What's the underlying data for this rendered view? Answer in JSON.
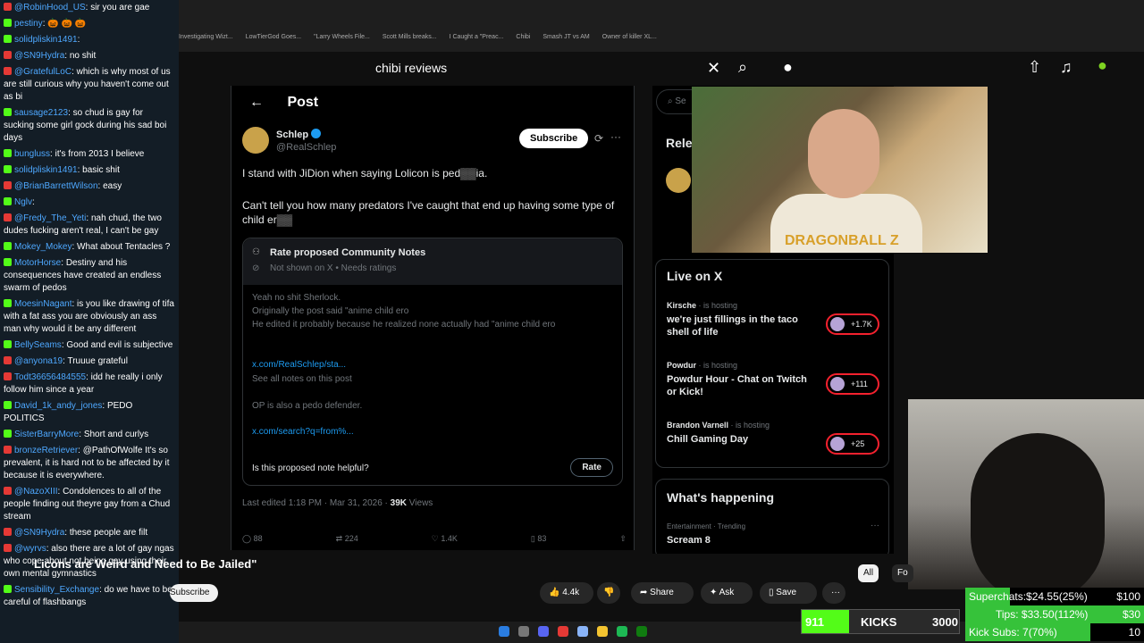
{
  "chat": [
    {
      "platform": "yt",
      "user": "@RobinHood_US",
      "text": "sir you are gae"
    },
    {
      "platform": "kick",
      "user": "pestiny",
      "text": "🎃 🎃 🎃"
    },
    {
      "platform": "kick",
      "user": "solidpliskin1491",
      "text": ""
    },
    {
      "platform": "yt",
      "user": "@SN9Hydra",
      "text": "no shit"
    },
    {
      "platform": "yt",
      "user": "@GratefulLoC",
      "text": "which is why most of us are still curious why you haven't come out as bi"
    },
    {
      "platform": "kick",
      "user": "sausage2123",
      "text": "so chud is gay for sucking some girl gock during his sad boi days"
    },
    {
      "platform": "kick",
      "user": "bungluss",
      "text": "it's from 2013 I believe"
    },
    {
      "platform": "kick",
      "user": "solidpliskin1491",
      "text": "basic shit"
    },
    {
      "platform": "yt",
      "user": "@BrianBarrettWilson",
      "text": "easy"
    },
    {
      "platform": "kick",
      "user": "Nglv",
      "text": ""
    },
    {
      "platform": "yt",
      "user": "@Fredy_The_Yeti",
      "text": "nah chud, the two dudes fucking aren't real, I can't be gay"
    },
    {
      "platform": "kick",
      "user": "Mokey_Mokey",
      "text": "What about Tentacles ?"
    },
    {
      "platform": "kick",
      "user": "MotorHorse",
      "text": "Destiny and his consequences have created an endless swarm of pedos"
    },
    {
      "platform": "kick",
      "user": "MoesinNagant",
      "text": "is you like drawing of tifa with a fat ass you are obviously an ass man why would it be any different"
    },
    {
      "platform": "kick",
      "user": "BellySeams",
      "text": "Good and evil is subjective"
    },
    {
      "platform": "yt",
      "user": "@anyona19",
      "text": "Truuue grateful"
    },
    {
      "platform": "yt",
      "user": "Todt36656484555",
      "text": "idd he really i only follow him since a year"
    },
    {
      "platform": "kick",
      "user": "David_1k_andy_jones",
      "text": "PEDO POLITICS"
    },
    {
      "platform": "kick",
      "user": "SisterBarryMore",
      "text": "Short and curlys"
    },
    {
      "platform": "yt",
      "user": "bronzeRetriever",
      "text": "@PathOfWolfe It's so prevalent, it is hard not to be affected by it because it is everywhere."
    },
    {
      "platform": "yt",
      "user": "@NazoXIII",
      "text": "Condolences to all of the people finding out theyre gay from a Chud stream"
    },
    {
      "platform": "yt",
      "user": "@SN9Hydra",
      "text": "these people are filt"
    },
    {
      "platform": "yt",
      "user": "@wyrvs",
      "text": "also there are a lot of gay ngas who cope about not being gay using their own mental gymnastics"
    },
    {
      "platform": "kick",
      "user": "Sensibility_Exchange",
      "text": "do we have to be careful of flashbangs"
    }
  ],
  "bookmarks": [
    "Investigating Wizt...",
    "LowTierGod Goes...",
    "\"Larry Wheels File...",
    "Scott Mills breaks...",
    "I Caught a \"Preac...",
    "Chibi",
    "Smash JT vs AM",
    "Owner of killer XL..."
  ],
  "yt": {
    "search_value": "chibi reviews",
    "video_title": "Licons are Weird and Need to Be Jailed\"",
    "subscribe": "Subscribe",
    "likes": "4.4k",
    "share": "Share",
    "ask": "Ask",
    "save": "Save",
    "chip_all": "All",
    "chip_fo": "Fo"
  },
  "post": {
    "header": "Post",
    "author": "Schlep",
    "handle": "@RealSchlep",
    "subscribe": "Subscribe",
    "line1": "I stand with JiDion when saying Lolicon is ped",
    "line1_end": "ia.",
    "line2": "Can't tell you how many predators I've caught that end up having some type of child er",
    "notes_title": "Rate proposed Community Notes",
    "notes_sub": "Not shown on X • Needs ratings",
    "note1": "Yeah no shit Sherlock.",
    "note2": "Originally the post said \"anime child ero",
    "note3": "He edited it probably because he realized none actually had \"anime child ero",
    "link1": "x.com/RealSchlep/sta...",
    "see_all": "See all notes on this post",
    "op": "OP is also a pedo defender.",
    "link2": "x.com/search?q=from%...",
    "helpful": "Is this proposed note helpful?",
    "rate": "Rate",
    "meta_time": "Last edited 1:18 PM · Mar 31, 2026 · ",
    "meta_views": "39K",
    "meta_views_lbl": " Views",
    "replies": "88",
    "reposts": "224",
    "post_likes": "1.4K",
    "bookmarks": "83"
  },
  "right": {
    "search": "Se",
    "relevant": "Rele",
    "live_title": "Live on X",
    "hosts": [
      {
        "name": "Kirsche",
        "title": "we're just fillings in the taco shell of life",
        "count": "+1.7K"
      },
      {
        "name": "Powdur",
        "title": "Powdur Hour - Chat on Twitch or Kick!",
        "count": "+111"
      },
      {
        "name": "Brandon Varnell",
        "title": "Chill Gaming Day",
        "count": "+25"
      }
    ],
    "hosting": "is hosting",
    "happening": "What's happening",
    "happen_cat": "Entertainment · Trending",
    "happen_item": "Scream 8"
  },
  "cam": {
    "shirt_text": "DRAGONBALL Z"
  },
  "goals": {
    "kicks_num": "911",
    "kicks_lbl": "KICKS",
    "kicks_goal": "3000",
    "kicks_progress": 0.3,
    "superchats_lbl": "Superchats:",
    "superchats_val": "$24.55(25%)",
    "superchats_goal": "$100",
    "superchats_progress": 0.25,
    "tips_lbl": "Tips:",
    "tips_val": "$33.50(112%)",
    "tips_goal": "$30",
    "tips_progress": 1.0,
    "subs_lbl": "Kick Subs:",
    "subs_val": "7(70%)",
    "subs_goal": "10",
    "subs_progress": 0.7
  },
  "colors": {
    "yt": "#e53935",
    "kick": "#53fc18",
    "x_blue": "#1d9bf0",
    "goal_green": "#36c23a"
  }
}
